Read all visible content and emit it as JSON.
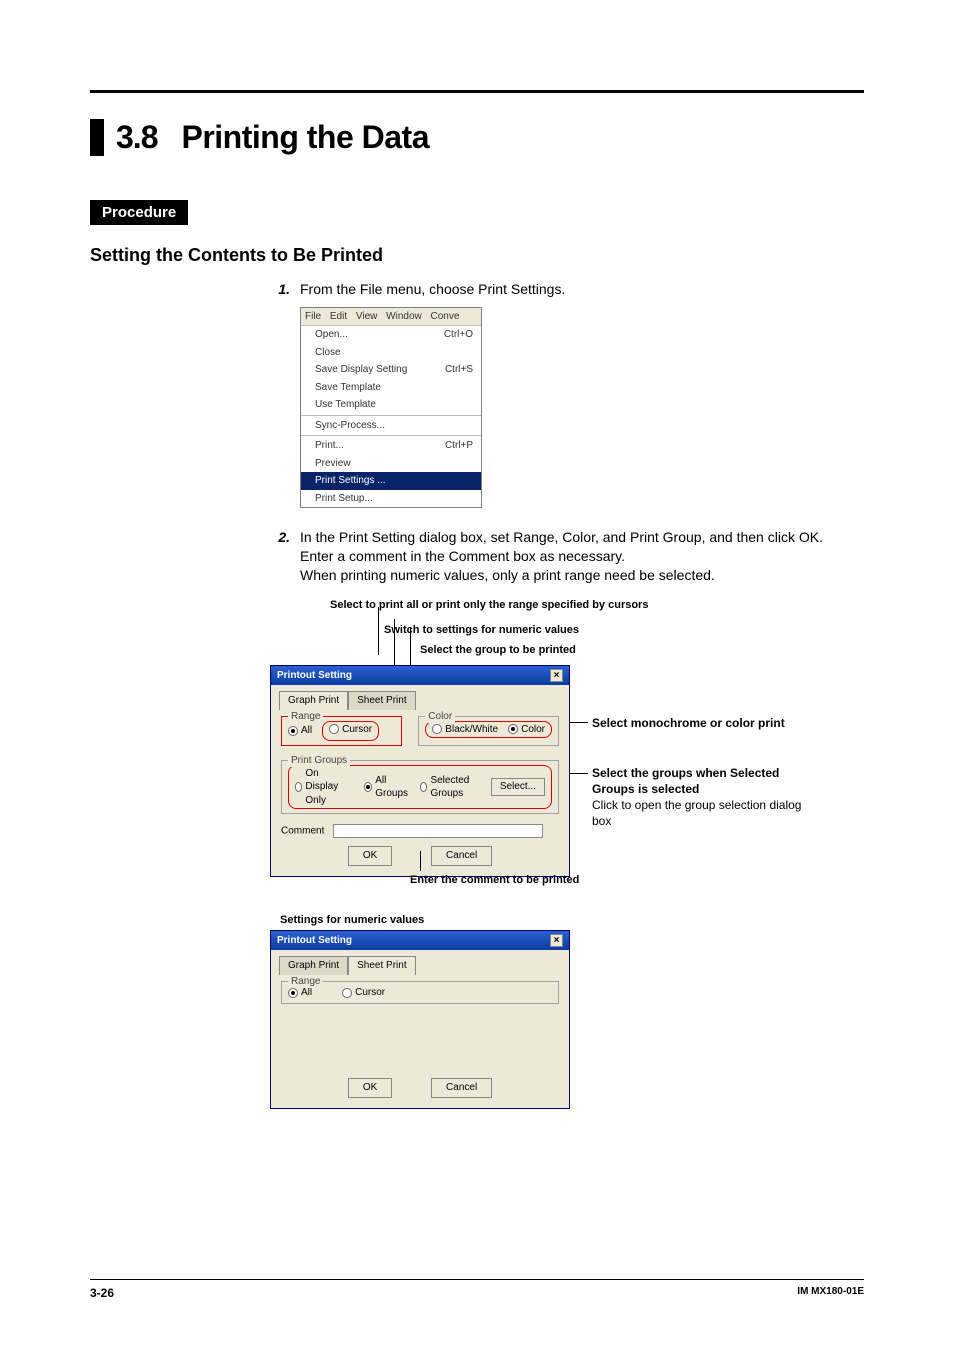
{
  "section": {
    "number": "3.8",
    "title": "Printing the Data"
  },
  "procedure_label": "Procedure",
  "subheading": "Setting the Contents to Be Printed",
  "steps": {
    "s1": {
      "num": "1.",
      "text": "From the File menu, choose Print Settings."
    },
    "s2": {
      "num": "2.",
      "text": "In the Print Setting dialog box, set Range, Color, and Print Group, and then click OK.",
      "l2": "Enter a comment in the Comment box as necessary.",
      "l3": "When printing numeric values, only a print range need be selected."
    }
  },
  "filemenu": {
    "bar": "File  Edit  View  Window  Conve",
    "open": "Open...",
    "open_sc": "Ctrl+O",
    "close": "Close",
    "savedisp": "Save Display Setting",
    "savedisp_sc": "Ctrl+S",
    "savetpl": "Save Template",
    "usetpl": "Use Template",
    "sync": "Sync-Process...",
    "print": "Print...",
    "print_sc": "Ctrl+P",
    "preview": "Preview",
    "psettings": "Print Settings ...",
    "psetup": "Print Setup..."
  },
  "callouts": {
    "c1": "Select to print all or print only the range specified by cursors",
    "c2": "Switch to settings for numeric values",
    "c3": "Select the group to be printed",
    "mono": "Select monochrome or color print",
    "groups": "Select the groups when Selected Groups is selected",
    "groups2": "Click to open the group selection dialog box",
    "enter": "Enter the comment to be printed",
    "numeric": "Settings for numeric values"
  },
  "dialog1": {
    "title": "Printout Setting",
    "tab_graph": "Graph Print",
    "tab_sheet": "Sheet Print",
    "range_lg": "Range",
    "color_lg": "Color",
    "all": "All",
    "cursor": "Cursor",
    "bw": "Black/White",
    "color": "Color",
    "pg_lg": "Print Groups",
    "ondisp": "On Display Only",
    "allgrp": "All Groups",
    "selgrp": "Selected Groups",
    "selbtn": "Select...",
    "comment": "Comment",
    "ok": "OK",
    "cancel": "Cancel"
  },
  "dialog2": {
    "title": "Printout Setting",
    "tab_graph": "Graph Print",
    "tab_sheet": "Sheet Print",
    "range_lg": "Range",
    "all": "All",
    "cursor": "Cursor",
    "ok": "OK",
    "cancel": "Cancel"
  },
  "footer": {
    "left": "3-26",
    "right": "IM MX180-01E"
  }
}
